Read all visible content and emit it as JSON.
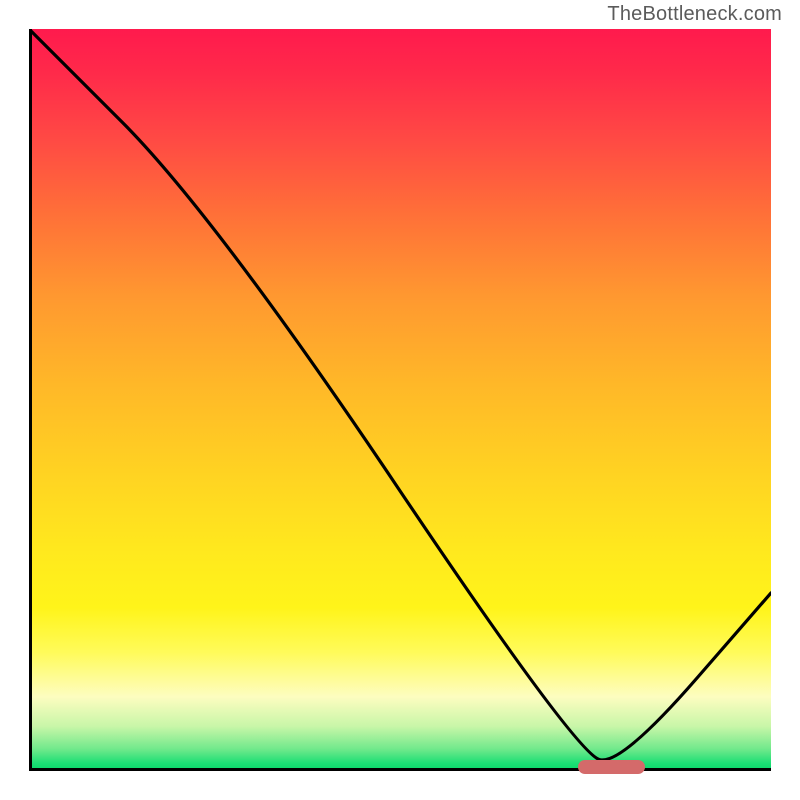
{
  "attribution": "TheBottleneck.com",
  "chart_data": {
    "type": "line",
    "title": "",
    "xlabel": "",
    "ylabel": "",
    "xlim": [
      0,
      100
    ],
    "ylim": [
      0,
      100
    ],
    "x": [
      0,
      25,
      74,
      80,
      100
    ],
    "values": [
      100,
      75,
      2,
      1,
      24
    ],
    "optimum_marker": {
      "x_start": 74,
      "x_end": 83,
      "y": 0.5
    },
    "background_gradient": {
      "direction": "vertical",
      "stops": [
        {
          "pos": 0.0,
          "color": "#ff1a4d"
        },
        {
          "pos": 0.36,
          "color": "#ff9830"
        },
        {
          "pos": 0.7,
          "color": "#ffe81e"
        },
        {
          "pos": 0.94,
          "color": "#c8f6a8"
        },
        {
          "pos": 1.0,
          "color": "#08d768"
        }
      ]
    }
  }
}
